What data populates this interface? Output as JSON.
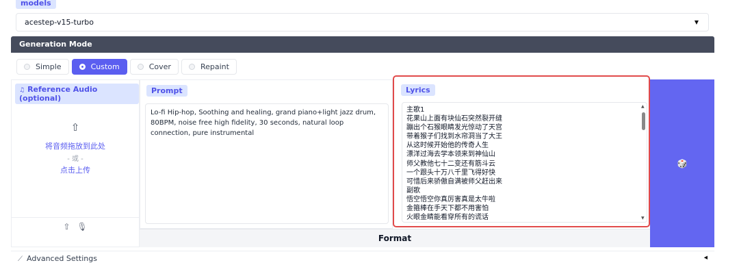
{
  "models": {
    "label": "models",
    "selected": "acestep-v15-turbo"
  },
  "generation_mode": {
    "title": "Generation Mode",
    "options": [
      {
        "label": "Simple",
        "selected": false
      },
      {
        "label": "Custom",
        "selected": true
      },
      {
        "label": "Cover",
        "selected": false
      },
      {
        "label": "Repaint",
        "selected": false
      }
    ]
  },
  "reference_audio": {
    "label": "Reference Audio (optional)",
    "drop_text": "将音频拖放到此处",
    "or_text": "- 或 -",
    "click_text": "点击上传"
  },
  "prompt": {
    "label": "Prompt",
    "text": "Lo-fi Hip-hop,   Soothing and healing, grand piano+light jazz drum, 80BPM, noise free high fidelity, 30 seconds, natural loop connection, pure instrumental"
  },
  "lyrics": {
    "label": "Lyrics",
    "lines": [
      "主歌1",
      "花果山上面有块仙石突然裂开缝",
      "蹦出个石猴眼睛发光惊动了天宫",
      "带着猴子们找到水帘洞当了大王",
      "从这时候开始他的传奇人生",
      "漂洋过海去学本领来到神仙山",
      "师父教他七十二变还有筋斗云",
      "一个跟头十万八千里飞得好快",
      "可惜后来骄傲自满被师父赶出来",
      "副歌",
      "悟空悟空你真厉害真是太牛啦",
      "金箍棒在手天下都不用害怕",
      "火眼金睛能看穿所有的谎话"
    ]
  },
  "format": {
    "label": "Format"
  },
  "advanced": {
    "label": "Advanced Settings"
  },
  "icons": {
    "dropdown": "chevron-down-icon",
    "upload": "upload-icon",
    "microphone": "microphone-icon",
    "dice": "dice-icon",
    "wand": "magic-wand-icon",
    "music": "music-note-icon"
  },
  "colors": {
    "accent": "#5b5ef0",
    "header_bg": "#454b5c",
    "highlight_border": "#e14a4a",
    "dice_bg": "#6366f1"
  }
}
